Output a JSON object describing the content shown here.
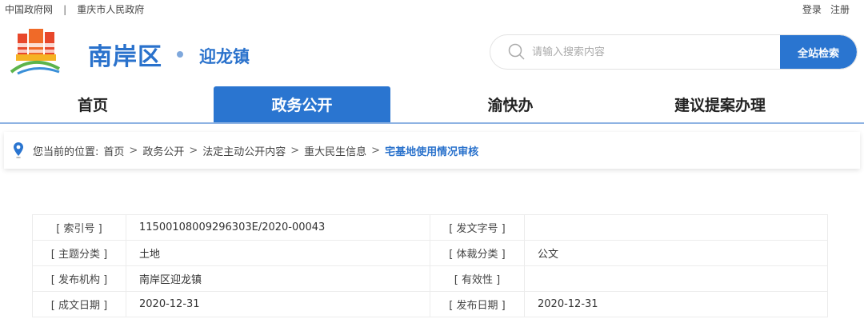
{
  "topbar": {
    "links": [
      "中国政府网",
      "重庆市人民政府"
    ],
    "separator": "|",
    "login": "登录",
    "register": "注册"
  },
  "header": {
    "title": "南岸区",
    "subtitle": "迎龙镇"
  },
  "search": {
    "placeholder": "请输入搜索内容",
    "button": "全站检索"
  },
  "nav": {
    "tabs": [
      "首页",
      "政务公开",
      "渝快办",
      "建议提案办理"
    ],
    "active": 1
  },
  "breadcrumb": {
    "prefix": "您当前的位置:",
    "items": [
      "首页",
      "政务公开",
      "法定主动公开内容",
      "重大民生信息"
    ],
    "current": "宅基地使用情况审核",
    "sep": ">"
  },
  "info": [
    {
      "l1": "[ 索引号 ]",
      "v1": "11500108009296303E/2020-00043",
      "l2": "[ 发文字号 ]",
      "v2": ""
    },
    {
      "l1": "[ 主题分类 ]",
      "v1": "土地",
      "l2": "[ 体裁分类 ]",
      "v2": "公文"
    },
    {
      "l1": "[ 发布机构 ]",
      "v1": "南岸区迎龙镇",
      "l2": "[ 有效性 ]",
      "v2": ""
    },
    {
      "l1": "[ 成文日期 ]",
      "v1": "2020-12-31",
      "l2": "[ 发布日期 ]",
      "v2": "2020-12-31"
    }
  ]
}
